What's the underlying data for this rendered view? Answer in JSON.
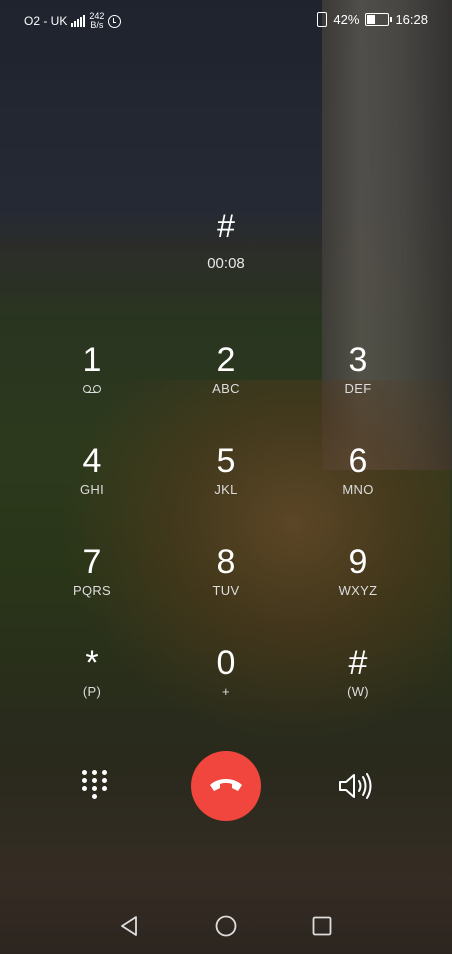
{
  "status_bar": {
    "carrier": "O2 - UK",
    "network_speed_value": "242",
    "network_speed_unit": "B/s",
    "battery_percent": "42%",
    "battery_level": 0.42,
    "time": "16:28",
    "icons": [
      "signal-icon",
      "alarm-icon",
      "vibrate-icon",
      "battery-icon"
    ]
  },
  "call": {
    "dialed": "#",
    "duration": "00:08"
  },
  "keypad": {
    "keys": [
      {
        "digit": "1",
        "letters": ""
      },
      {
        "digit": "2",
        "letters": "ABC"
      },
      {
        "digit": "3",
        "letters": "DEF"
      },
      {
        "digit": "4",
        "letters": "GHI"
      },
      {
        "digit": "5",
        "letters": "JKL"
      },
      {
        "digit": "6",
        "letters": "MNO"
      },
      {
        "digit": "7",
        "letters": "PQRS"
      },
      {
        "digit": "8",
        "letters": "TUV"
      },
      {
        "digit": "9",
        "letters": "WXYZ"
      },
      {
        "digit": "*",
        "letters": "(P)"
      },
      {
        "digit": "0",
        "letters": "+"
      },
      {
        "digit": "#",
        "letters": "(W)"
      }
    ]
  },
  "actions": {
    "dialpad_icon": "dialpad-icon",
    "end_call_icon": "end-call-icon",
    "end_call_color": "#f0463e",
    "speaker_icon": "speaker-icon"
  },
  "nav": {
    "icons": [
      "back-icon",
      "home-icon",
      "recents-icon"
    ]
  }
}
